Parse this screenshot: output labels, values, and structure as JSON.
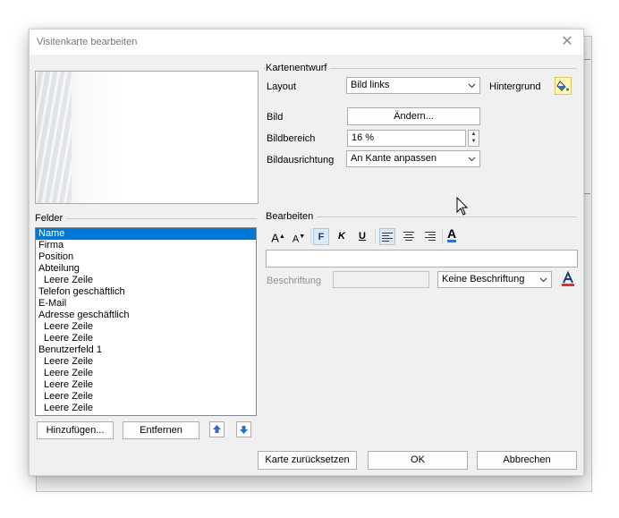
{
  "dialog": {
    "title": "Visitenkarte bearbeiten",
    "close_glyph": "✕"
  },
  "design": {
    "group_label": "Kartenentwurf",
    "layout_label": "Layout",
    "layout_value": "Bild links",
    "background_label": "Hintergrund",
    "image_label": "Bild",
    "change_button": "Ändern...",
    "image_area_label": "Bildbereich",
    "image_area_value": "16 %",
    "alignment_label": "Bildausrichtung",
    "alignment_value": "An Kante anpassen"
  },
  "fields": {
    "group_label": "Felder",
    "items": [
      {
        "label": "Name",
        "indent": false,
        "selected": true
      },
      {
        "label": "Firma",
        "indent": false,
        "selected": false
      },
      {
        "label": "Position",
        "indent": false,
        "selected": false
      },
      {
        "label": "Abteilung",
        "indent": false,
        "selected": false
      },
      {
        "label": "Leere Zeile",
        "indent": true,
        "selected": false
      },
      {
        "label": "Telefon geschäftlich",
        "indent": false,
        "selected": false
      },
      {
        "label": "E-Mail",
        "indent": false,
        "selected": false
      },
      {
        "label": "Adresse geschäftlich",
        "indent": false,
        "selected": false
      },
      {
        "label": "Leere Zeile",
        "indent": true,
        "selected": false
      },
      {
        "label": "Leere Zeile",
        "indent": true,
        "selected": false
      },
      {
        "label": "Benutzerfeld 1",
        "indent": false,
        "selected": false
      },
      {
        "label": "Leere Zeile",
        "indent": true,
        "selected": false
      },
      {
        "label": "Leere Zeile",
        "indent": true,
        "selected": false
      },
      {
        "label": "Leere Zeile",
        "indent": true,
        "selected": false
      },
      {
        "label": "Leere Zeile",
        "indent": true,
        "selected": false
      },
      {
        "label": "Leere Zeile",
        "indent": true,
        "selected": false
      }
    ],
    "add_button": "Hinzufügen...",
    "remove_button": "Entfernen"
  },
  "edit": {
    "group_label": "Bearbeiten",
    "grow_font": "A",
    "shrink_font": "A",
    "bold": "F",
    "italic": "K",
    "underline": "U",
    "font_color": "A",
    "text_value": "",
    "caption_label": "Beschriftung",
    "caption_value": "",
    "caption_mode": "Keine Beschriftung"
  },
  "footer": {
    "reset_button": "Karte zurücksetzen",
    "ok_button": "OK",
    "cancel_button": "Abbrechen"
  },
  "colors": {
    "selection": "#0078d7",
    "accent": "#1e6fbf",
    "font_color_bar": "#2e74c9"
  }
}
